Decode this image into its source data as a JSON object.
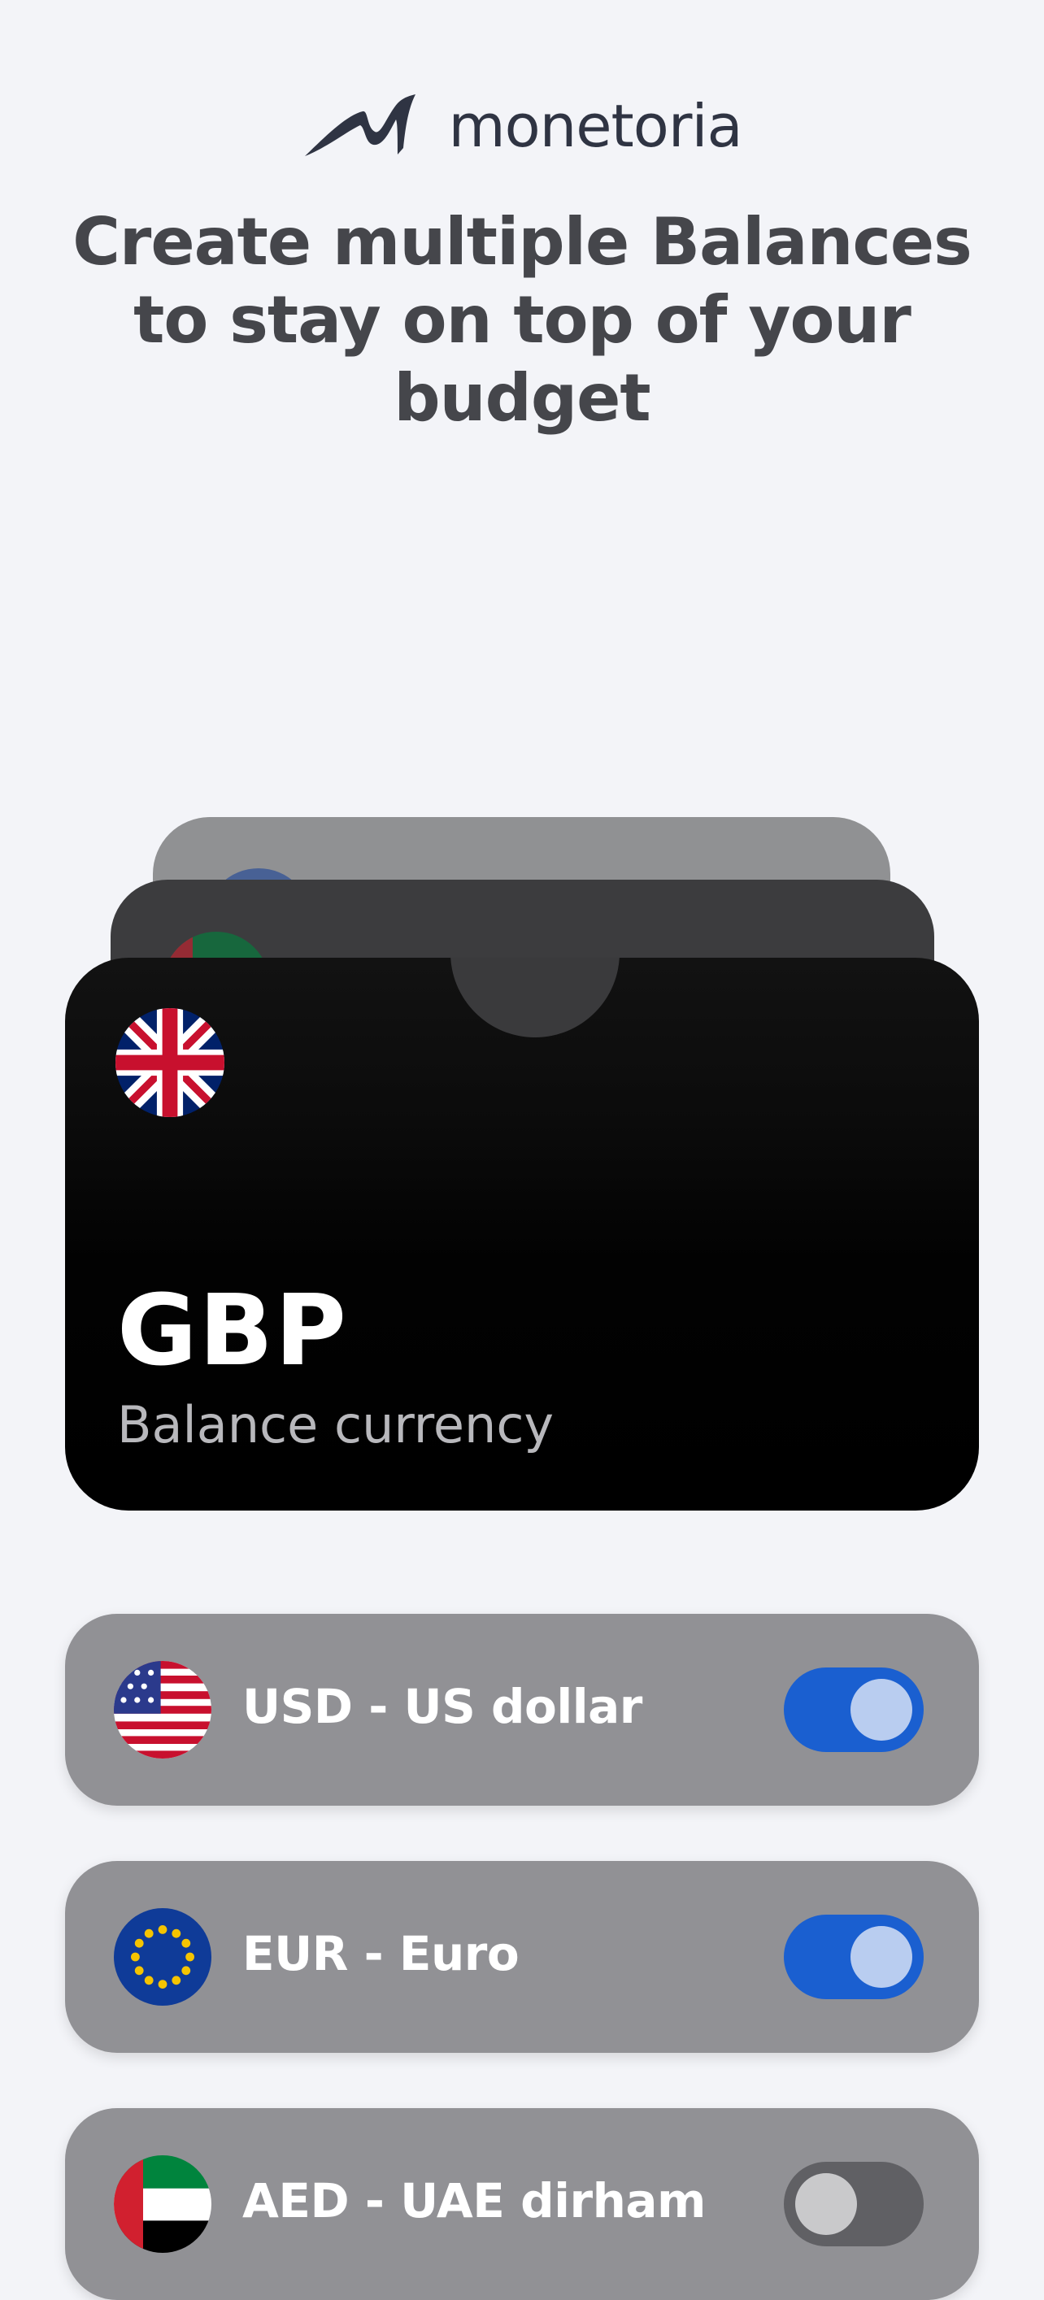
{
  "logo": {
    "text": "monetoria",
    "icon": "monetoria-logo-mark"
  },
  "headline": "Create multiple Balances to stay on top of your budget",
  "card": {
    "code": "GBP",
    "subtitle": "Balance currency",
    "flag": "gb-flag-icon",
    "stacked_flags": [
      "eu-flag-icon",
      "ae-flag-icon"
    ]
  },
  "currencies": [
    {
      "label": "USD - US dollar",
      "flag": "us-flag-icon",
      "enabled": true
    },
    {
      "label": "EUR - Euro",
      "flag": "eu-flag-icon",
      "enabled": true
    },
    {
      "label": "AED - UAE dirham",
      "flag": "ae-flag-icon",
      "enabled": false
    }
  ],
  "colors": {
    "background": "#f3f4f8",
    "headline": "#45464b",
    "toggle_on": "#1a5fd0",
    "toggle_off": "#606064",
    "row_bg": "#919195"
  }
}
